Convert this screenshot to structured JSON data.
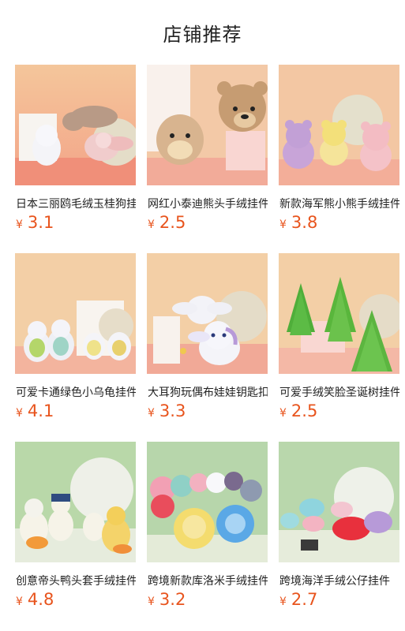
{
  "header": {
    "title": "店铺推荐"
  },
  "products": [
    {
      "name": "日本三丽鸥毛绒玉桂狗挂件",
      "currency": "¥",
      "price": "3.1",
      "image": "cinnamoroll-plush-keychains",
      "bg_top": "#f4c79a",
      "bg_bottom": "#f3a487"
    },
    {
      "name": "网红小泰迪熊头手绒挂件",
      "currency": "¥",
      "price": "2.5",
      "image": "teddy-bear-head-plush",
      "bg_top": "#f2c9a6",
      "bg_bottom": "#f4b6a0"
    },
    {
      "name": "新款海军熊小熊手绒挂件",
      "currency": "¥",
      "price": "3.8",
      "image": "sailor-bear-plush-trio",
      "bg_top": "#f2c8a3",
      "bg_bottom": "#f3b59c"
    },
    {
      "name": "可爱卡通绿色小乌龟挂件",
      "currency": "¥",
      "price": "4.1",
      "image": "bunny-turtle-plush-keychains",
      "bg_top": "#f3cfa6",
      "bg_bottom": "#f3b89d"
    },
    {
      "name": "大耳狗玩偶布娃娃钥匙扣",
      "currency": "¥",
      "price": "3.3",
      "image": "cinnamoroll-doll-keychain",
      "bg_top": "#f3cfa6",
      "bg_bottom": "#f2b29b"
    },
    {
      "name": "可爱手绒笑脸圣诞树挂件",
      "currency": "¥",
      "price": "2.5",
      "image": "christmas-tree-plush",
      "bg_top": "#f3cfa6",
      "bg_bottom": "#f3b89d"
    },
    {
      "name": "创意帝头鸭头套手绒挂件",
      "currency": "¥",
      "price": "4.8",
      "image": "duck-hood-plush-keychains",
      "bg_top": "#b8d7a8",
      "bg_bottom": "#dfe7d2"
    },
    {
      "name": "跨境新款库洛米手绒挂件",
      "currency": "¥",
      "price": "3.2",
      "image": "sanrio-hood-plush-assortment",
      "bg_top": "#b7d6ab",
      "bg_bottom": "#e2ead6"
    },
    {
      "name": "跨境海洋手绒公仔挂件",
      "currency": "¥",
      "price": "2.7",
      "image": "sea-creature-plush-crabs",
      "bg_top": "#b9d7ac",
      "bg_bottom": "#e4ebda"
    }
  ]
}
